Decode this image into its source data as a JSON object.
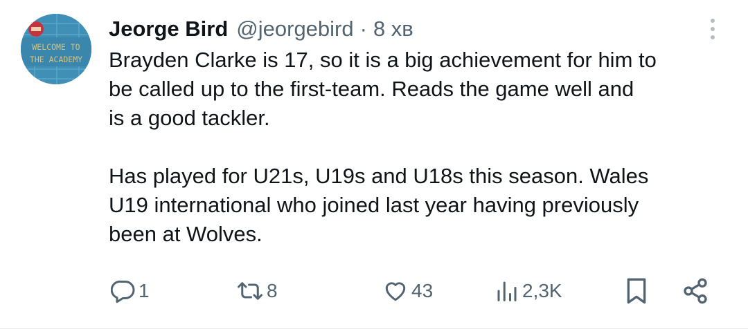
{
  "author": {
    "display_name": "Jeorge Bird",
    "handle": "@jeorgebird",
    "separator": "·",
    "time": "8 хв",
    "avatar_text_line1": "WELCOME TO",
    "avatar_text_line2": "THE ACADEMY"
  },
  "tweet": {
    "text": "Brayden Clarke is 17, so it is a big achievement for him to\nbe called up to the first-team. Reads the game well and\nis a good tackler.\n\nHas played for U21s, U19s and U18s this season. Wales\nU19 international who joined last year having previously\nbeen at Wolves."
  },
  "actions": {
    "replies": "1",
    "retweets": "8",
    "likes": "43",
    "views": "2,3K"
  },
  "icons": {
    "reply": "reply-icon",
    "retweet": "retweet-icon",
    "like": "heart-icon",
    "views": "views-icon",
    "bookmark": "bookmark-icon",
    "share": "share-icon",
    "more": "more-vertical-icon"
  },
  "colors": {
    "text": "#0f1419",
    "secondary": "#536471",
    "avatar_bg": "#3f8fb6"
  }
}
